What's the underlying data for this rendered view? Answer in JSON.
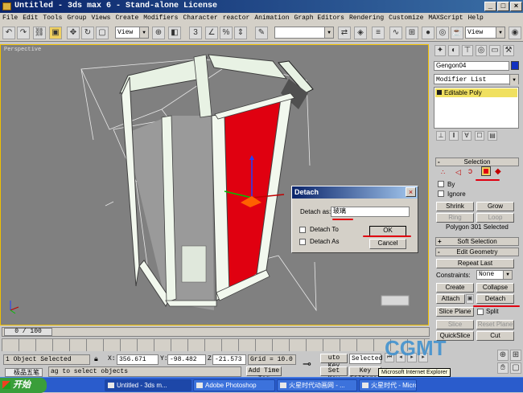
{
  "window": {
    "title": "Untitled - 3ds max 6 - Stand-alone License"
  },
  "menu": [
    "File",
    "Edit",
    "Tools",
    "Group",
    "Views",
    "Create",
    "Modifiers",
    "Character",
    "reactor",
    "Animation",
    "Graph Editors",
    "Rendering",
    "Customize",
    "MAXScript",
    "Help"
  ],
  "toolbar": {
    "refcoord": "View",
    "refcoord2": "View"
  },
  "viewport": {
    "label": "Perspective"
  },
  "panel": {
    "object_name": "Gengon04",
    "modifier_list": "Modifier List",
    "stack_item": "Editable Poly",
    "selection_title": "Selection",
    "by_label": "By",
    "ignore_label": "Ignore",
    "shrink": "Shrink",
    "grow": "Grow",
    "ring": "Ring",
    "loop": "Loop",
    "status": "Polygon 301 Selected",
    "soft_title": "Soft Selection",
    "edit_title": "Edit Geometry",
    "repeat_last": "Repeat Last",
    "constraints_label": "Constraints:",
    "constraints_value": "None",
    "create": "Create",
    "collapse": "Collapse",
    "attach": "Attach",
    "detach": "Detach",
    "slice_plane": "Slice Plane",
    "split": "Split",
    "slice": "Slice",
    "reset_plane": "Reset Plane",
    "quickslice": "QuickSlice",
    "cut": "Cut"
  },
  "dialog": {
    "title": "Detach",
    "detach_as_label": "Detach as:",
    "detach_as_value": "玻璃",
    "detach_to_face": "Detach To",
    "detach_as_clone": "Detach As",
    "ok": "OK",
    "cancel": "Cancel"
  },
  "timeline": {
    "frame": "0 / 100"
  },
  "status": {
    "selected": "1 Object Selected",
    "hint": "ag to select objects",
    "x": "356.671",
    "y": "-98.482",
    "z": "-21.573",
    "grid": "Grid = 10.0",
    "add_time_tag": "Add Time Tag",
    "auto_key": "uto Key",
    "set_key": "Set Key",
    "selected_btn": "Selected",
    "key_filters": "Key Filters..."
  },
  "taskbar": {
    "start": "开始",
    "ime": "极品五笔",
    "tasks": [
      "Untitled - 3ds m...",
      "Adobe Photoshop",
      "火星时代动画网 - ...",
      "火星时代 - Micro..."
    ],
    "tooltip": "Microsoft Internet Explorer"
  },
  "watermark": "CGMT",
  "colors": {
    "accent": "#f0c000",
    "selected_face": "#e00010",
    "title_bar": "#0a246a"
  }
}
